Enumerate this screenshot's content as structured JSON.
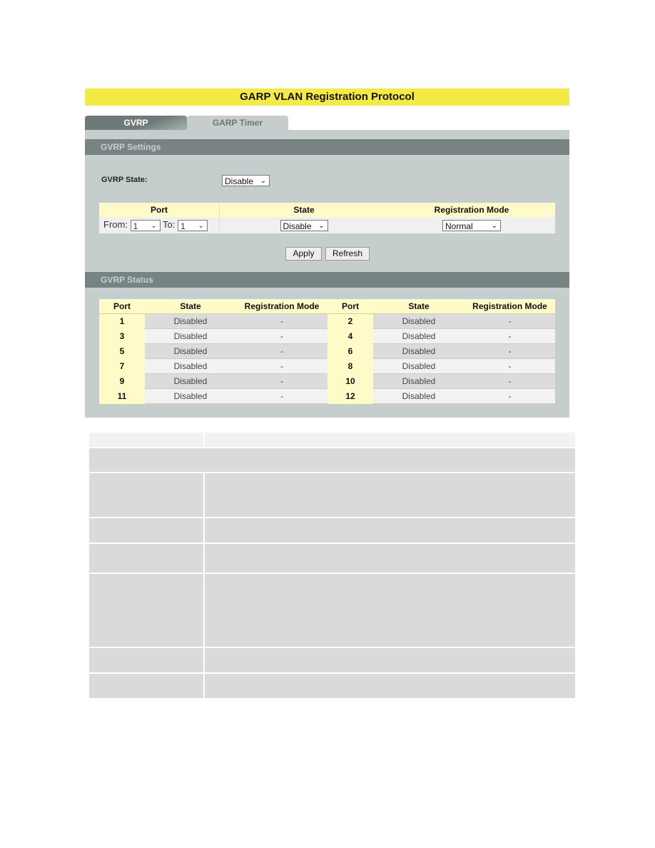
{
  "title": "GARP VLAN Registration Protocol",
  "tabs": [
    {
      "label": "GVRP",
      "active": true
    },
    {
      "label": "GARP Timer",
      "active": false
    }
  ],
  "settings": {
    "header": "GVRP Settings",
    "gvrp_state_label": "GVRP State:",
    "gvrp_state_value": "Disable",
    "columns": [
      "Port",
      "State",
      "Registration Mode"
    ],
    "from_label": "From:",
    "from_value": "1",
    "to_label": "To:",
    "to_value": "1",
    "state_value": "Disable",
    "mode_value": "Normal",
    "apply_label": "Apply",
    "refresh_label": "Refresh"
  },
  "status": {
    "header": "GVRP Status",
    "columns": [
      "Port",
      "State",
      "Registration Mode",
      "Port",
      "State",
      "Registration Mode"
    ],
    "rows": [
      [
        "1",
        "Disabled",
        "-",
        "2",
        "Disabled",
        "-"
      ],
      [
        "3",
        "Disabled",
        "-",
        "4",
        "Disabled",
        "-"
      ],
      [
        "5",
        "Disabled",
        "-",
        "6",
        "Disabled",
        "-"
      ],
      [
        "7",
        "Disabled",
        "-",
        "8",
        "Disabled",
        "-"
      ],
      [
        "9",
        "Disabled",
        "-",
        "10",
        "Disabled",
        "-"
      ],
      [
        "11",
        "Disabled",
        "-",
        "12",
        "Disabled",
        "-"
      ]
    ]
  },
  "colors": {
    "title_bg": "#f5ea45",
    "panel_bg": "#c5cdcd",
    "section_header": "#778483",
    "table_header": "#fefbc8"
  }
}
